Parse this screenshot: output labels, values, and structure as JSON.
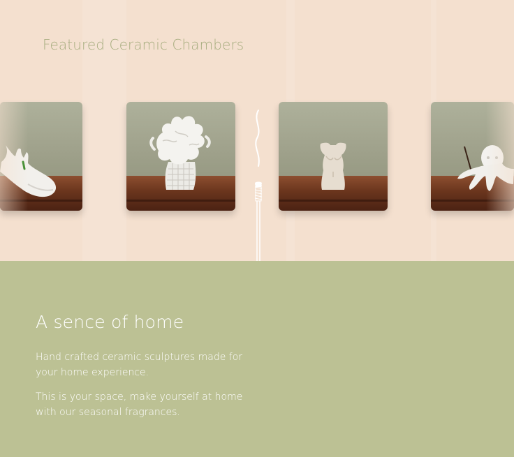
{
  "featured": {
    "title": "Featured Ceramic Chambers",
    "cards": [
      {
        "icon": "ceramic-hand-icon"
      },
      {
        "icon": "ceramic-dragon-icon"
      },
      {
        "icon": "ceramic-torso-icon"
      },
      {
        "icon": "ceramic-octopus-icon"
      }
    ]
  },
  "about": {
    "heading": "A sence of home",
    "paragraph_1": "Hand crafted ceramic sculptures made for your home experience.",
    "paragraph_2": "This is your space, make yourself at home with our seasonal fragrances."
  },
  "colors": {
    "top_background": "#f4e0cf",
    "bottom_background": "#bcc194",
    "title_color": "#a7ad7f"
  }
}
